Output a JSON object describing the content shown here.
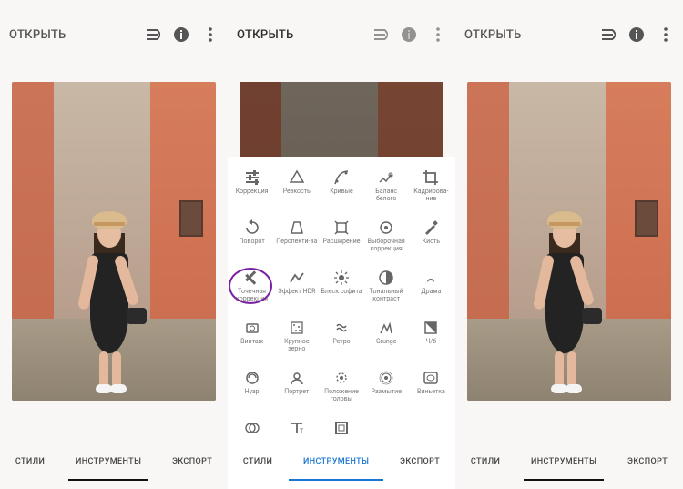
{
  "app_header": {
    "open_label": "ОТКРЫТЬ"
  },
  "tabs": {
    "styles": "СТИЛИ",
    "tools": "ИНСТРУМЕНТЫ",
    "export": "ЭКСПОРТ"
  },
  "active_tab_screens": [
    "tools",
    "tools",
    "tools"
  ],
  "highlighted_tool_index": 10,
  "tools": [
    {
      "id": "tune",
      "label": "Коррекция"
    },
    {
      "id": "details",
      "label": "Резкость"
    },
    {
      "id": "curves",
      "label": "Кривые"
    },
    {
      "id": "whitebalance",
      "label": "Баланс белого"
    },
    {
      "id": "crop",
      "label": "Кадрирова-ние"
    },
    {
      "id": "rotate",
      "label": "Поворот"
    },
    {
      "id": "perspective",
      "label": "Перспекти-ва"
    },
    {
      "id": "expand",
      "label": "Расширение"
    },
    {
      "id": "selective",
      "label": "Выборочная коррекция"
    },
    {
      "id": "brush",
      "label": "Кисть"
    },
    {
      "id": "healing",
      "label": "Точечная коррекция"
    },
    {
      "id": "hdr",
      "label": "Эффект HDR"
    },
    {
      "id": "glamour",
      "label": "Блеск софита"
    },
    {
      "id": "tonal",
      "label": "Тональный контраст"
    },
    {
      "id": "drama",
      "label": "Драма"
    },
    {
      "id": "vintage",
      "label": "Винтаж"
    },
    {
      "id": "grainy",
      "label": "Крупное зерно"
    },
    {
      "id": "retrolux",
      "label": "Ретро"
    },
    {
      "id": "grunge",
      "label": "Grunge"
    },
    {
      "id": "bw",
      "label": "Ч/б"
    },
    {
      "id": "noir",
      "label": "Нуар"
    },
    {
      "id": "portrait",
      "label": "Портрет"
    },
    {
      "id": "headpose",
      "label": "Положение головы"
    },
    {
      "id": "lensblur",
      "label": "Размытие"
    },
    {
      "id": "vignette",
      "label": "Виньетка"
    },
    {
      "id": "doubleexp",
      "label": "Двойная экспозиция"
    },
    {
      "id": "text",
      "label": "Текст"
    },
    {
      "id": "frames",
      "label": "Рамки"
    }
  ],
  "colors": {
    "accent_blue": "#1976d2",
    "highlight_ring": "#7b1fa2"
  }
}
